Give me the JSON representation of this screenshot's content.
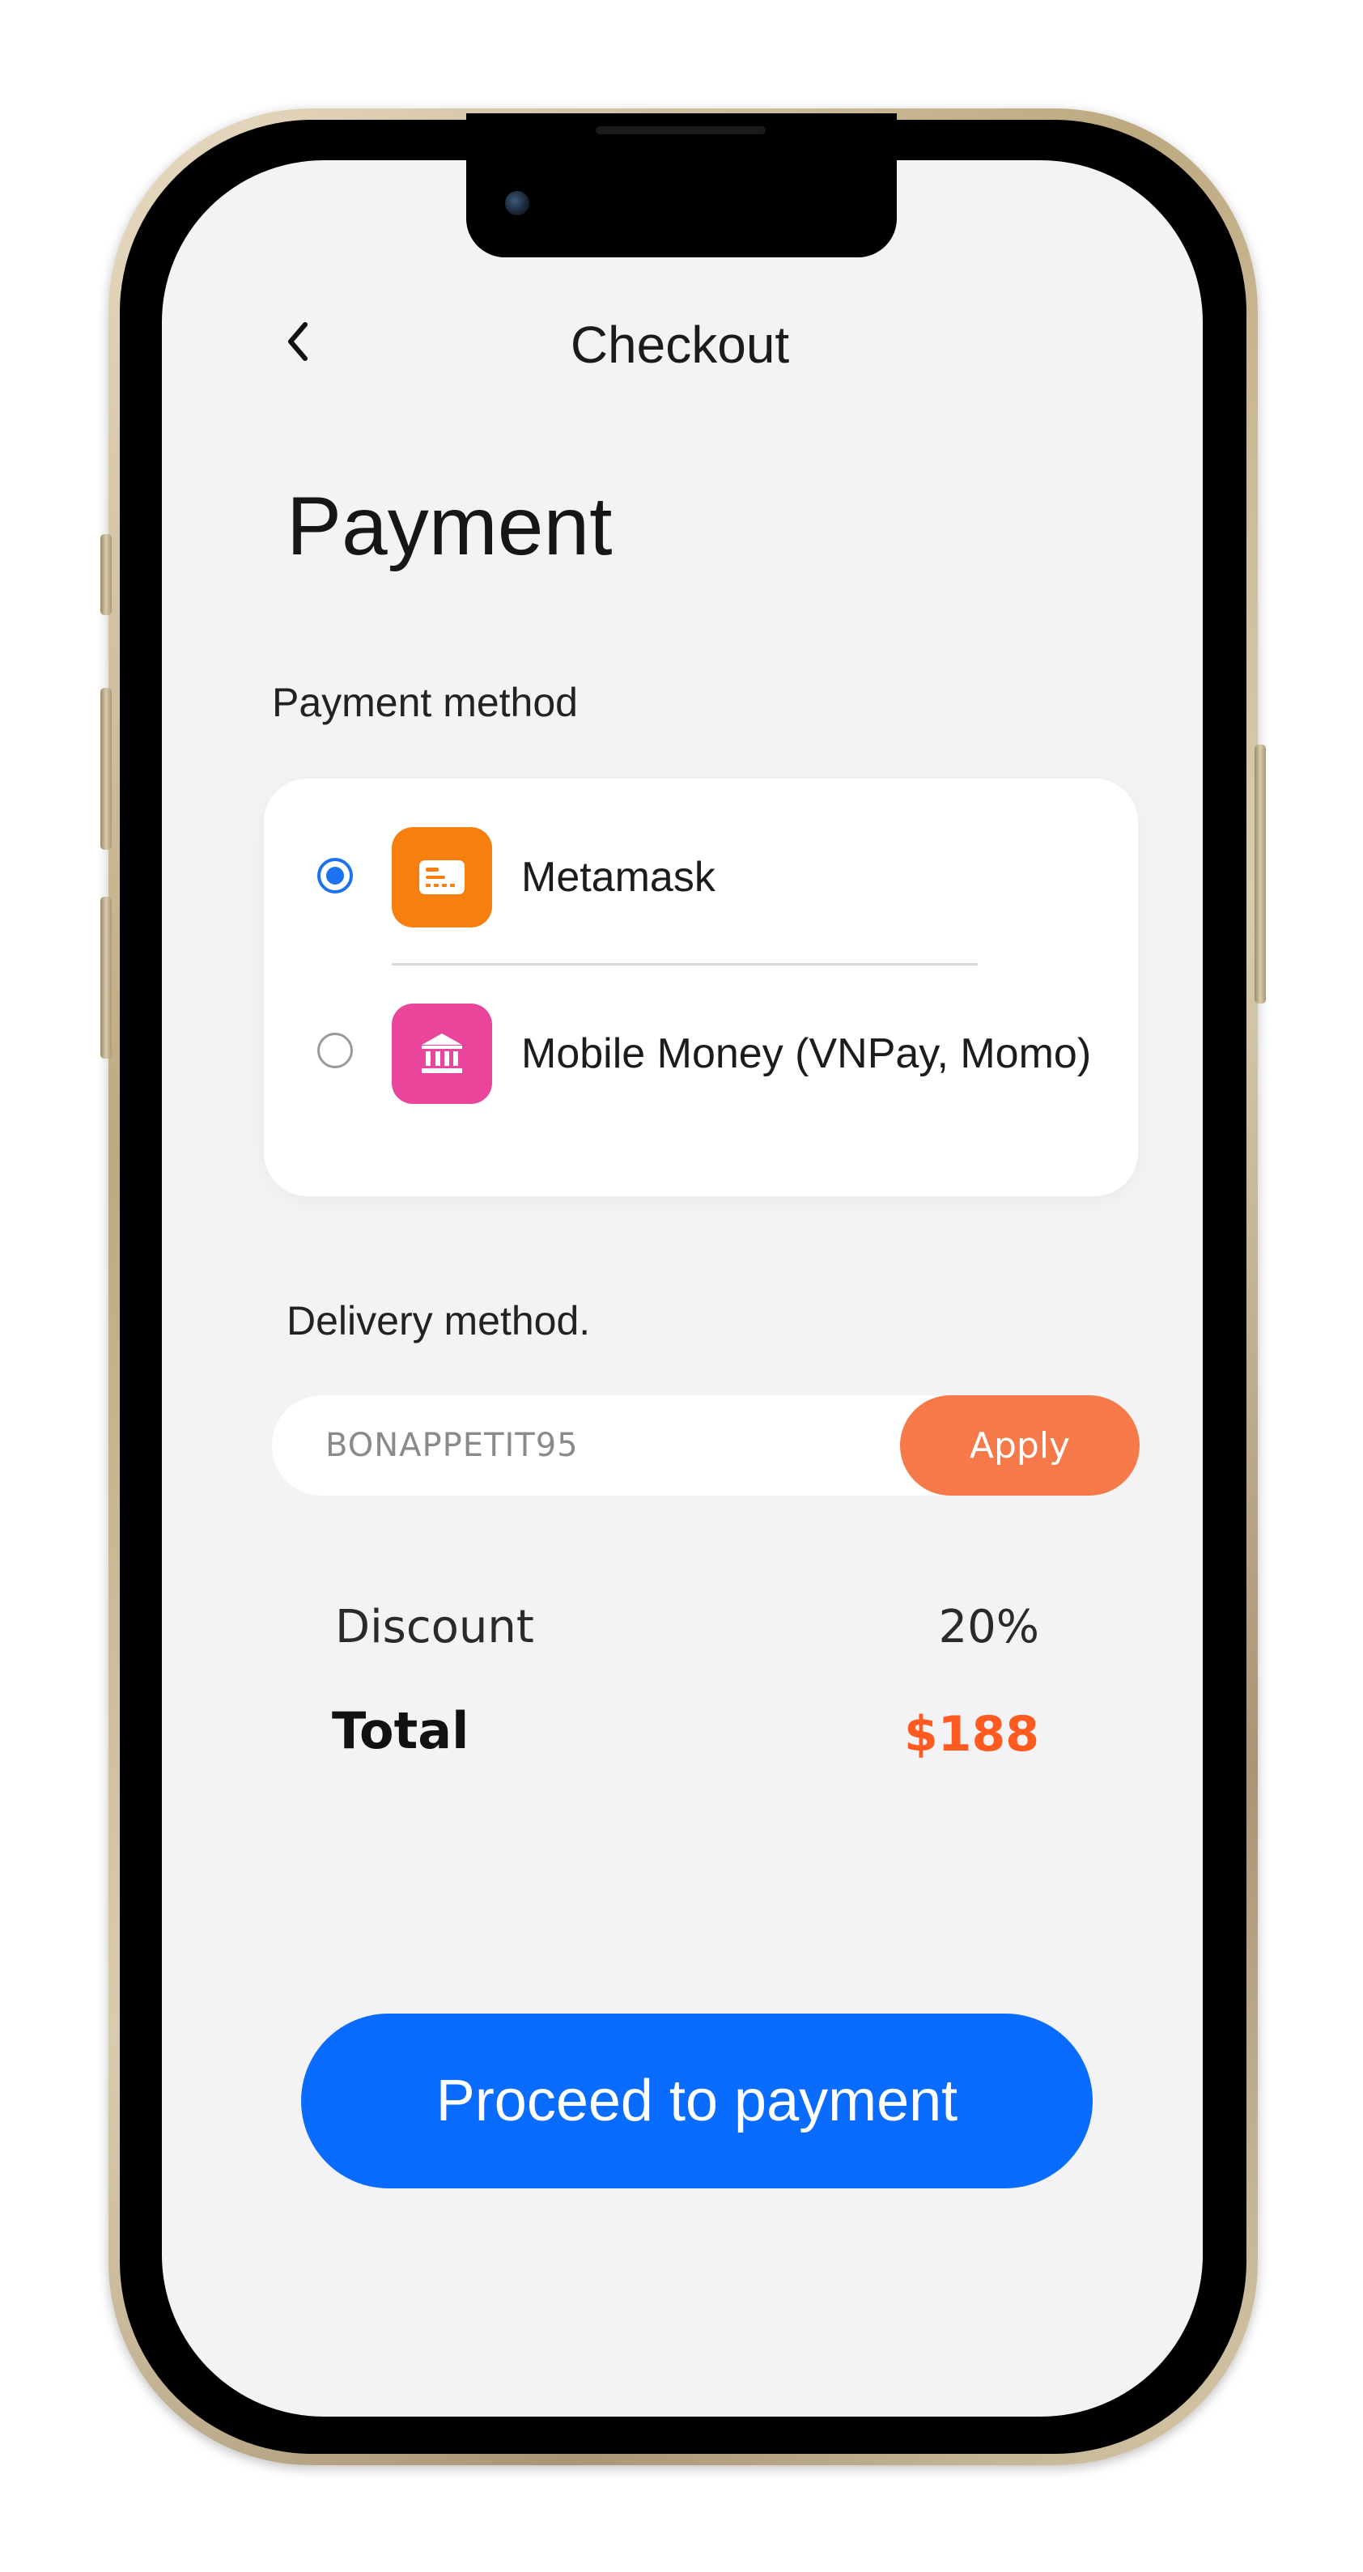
{
  "header": {
    "back_icon": "chevron-left-icon",
    "title": "Checkout"
  },
  "page": {
    "title": "Payment"
  },
  "payment": {
    "section_label": "Payment method",
    "methods": [
      {
        "label": "Metamask",
        "icon": "card-icon",
        "icon_color": "#f77f0e",
        "selected": true
      },
      {
        "label": "Mobile Money (VNPay, Momo)",
        "icon": "bank-icon",
        "icon_color": "#e9459a",
        "selected": false
      }
    ]
  },
  "delivery": {
    "section_label": "Delivery method.",
    "promo_value": "BONAPPETIT95",
    "apply_label": "Apply"
  },
  "summary": {
    "discount_label": "Discount",
    "discount_value": "20%",
    "total_label": "Total",
    "total_value": "$188"
  },
  "actions": {
    "proceed_label": "Proceed to payment"
  },
  "colors": {
    "accent_blue": "#0a6cff",
    "apply_orange": "#f6794a",
    "total_orange": "#ff5a1f",
    "screen_background": "#f3f3f6"
  }
}
